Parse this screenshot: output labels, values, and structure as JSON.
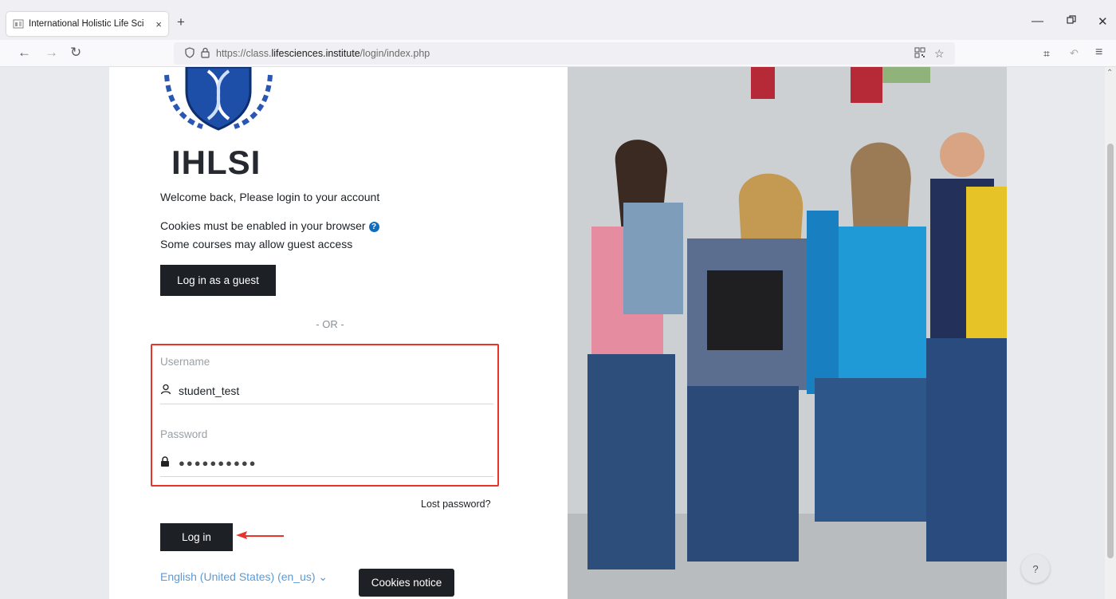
{
  "browser": {
    "tab_title": "International Holistic Life Sci",
    "tab_close": "×",
    "new_tab": "+",
    "url_scheme_host_prefix": "https://class.",
    "url_host_strong": "lifesciences.institute",
    "url_path": "/login/index.php"
  },
  "login": {
    "brand": "IHLSI",
    "welcome": "Welcome back, Please login to your account",
    "cookies_text": "Cookies must be enabled in your browser",
    "guest_text": "Some courses may allow guest access",
    "guest_button": "Log in as a guest",
    "or_divider": "- OR -",
    "username_label": "Username",
    "username_value": "student_test",
    "password_label": "Password",
    "password_value": "●●●●●●●●●●",
    "lost_password": "Lost password?",
    "login_button": "Log in",
    "language": "English (United States) (en_us) ⌄",
    "cookies_notice": "Cookies notice"
  },
  "help_fab": "?",
  "colors": {
    "highlight": "#e8342b",
    "dark_button": "#1d2125",
    "link": "#5b9ad5",
    "help_icon": "#0f6cbf"
  }
}
